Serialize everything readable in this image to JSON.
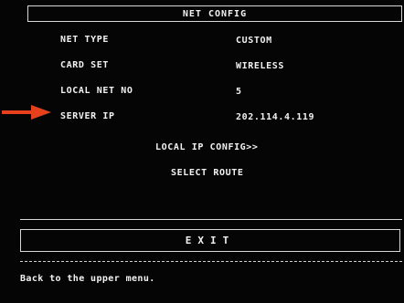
{
  "title": "NET CONFIG",
  "rows": [
    {
      "label": "NET TYPE",
      "value": "CUSTOM"
    },
    {
      "label": "CARD SET",
      "value": "WIRELESS"
    },
    {
      "label": "LOCAL NET NO",
      "value": "5"
    },
    {
      "label": "SERVER IP",
      "value": "202.114.4.119"
    }
  ],
  "menu": {
    "local_ip_config": "LOCAL IP CONFIG>>",
    "select_route": "SELECT ROUTE"
  },
  "exit_label": "EXIT",
  "help_text": "Back to the upper menu.",
  "colors": {
    "background": "#050505",
    "text": "#f2f2f2",
    "arrow": "#e8401c"
  },
  "annotation_icon": "red-arrow-icon"
}
